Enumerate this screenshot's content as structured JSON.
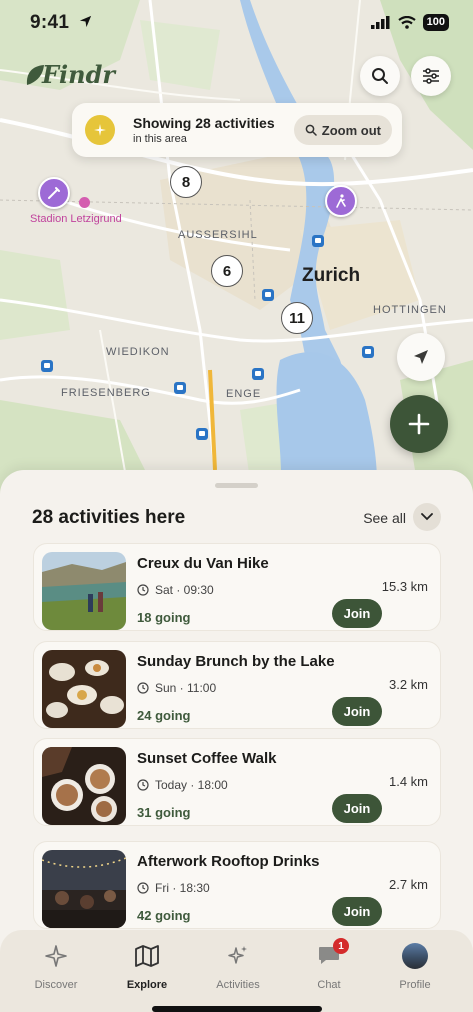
{
  "status": {
    "time": "9:41",
    "battery": "100"
  },
  "app": {
    "logo": "Findr"
  },
  "banner": {
    "title": "Showing 28 activities",
    "subtitle": "in this area",
    "zoom_label": "Zoom out"
  },
  "map": {
    "clusters": [
      "8",
      "6",
      "11"
    ],
    "city": "Zurich",
    "districts": [
      "AUSSERSIHL",
      "HOTTINGEN",
      "WIEDIKON",
      "FRIESENBERG",
      "ENGE"
    ],
    "poi": "Stadion Letzigrund"
  },
  "sheet": {
    "title": "28 activities here",
    "see_all": "See all"
  },
  "activities": [
    {
      "title": "Creux du Van Hike",
      "when": "Sat · 09:30",
      "going": "18 going",
      "distance": "15.3 km",
      "join": "Join"
    },
    {
      "title": "Sunday Brunch by the Lake",
      "when": "Sun · 11:00",
      "going": "24 going",
      "distance": "3.2 km",
      "join": "Join"
    },
    {
      "title": "Sunset Coffee Walk",
      "when": "Today · 18:00",
      "going": "31 going",
      "distance": "1.4 km",
      "join": "Join"
    },
    {
      "title": "Afterwork Rooftop Drinks",
      "when": "Fri · 18:30",
      "going": "42 going",
      "distance": "2.7 km",
      "join": "Join"
    }
  ],
  "tabs": [
    {
      "label": "Discover",
      "icon": "compass-star-icon"
    },
    {
      "label": "Explore",
      "icon": "map-icon"
    },
    {
      "label": "Activities",
      "icon": "sparkles-icon"
    },
    {
      "label": "Chat",
      "icon": "chat-bubble-icon",
      "badge": "1"
    },
    {
      "label": "Profile",
      "icon": "avatar"
    }
  ],
  "colors": {
    "brand": "#3d5538",
    "pin": "#9d6ad6",
    "water": "#a7c8ea",
    "badge": "#d42b2b"
  }
}
